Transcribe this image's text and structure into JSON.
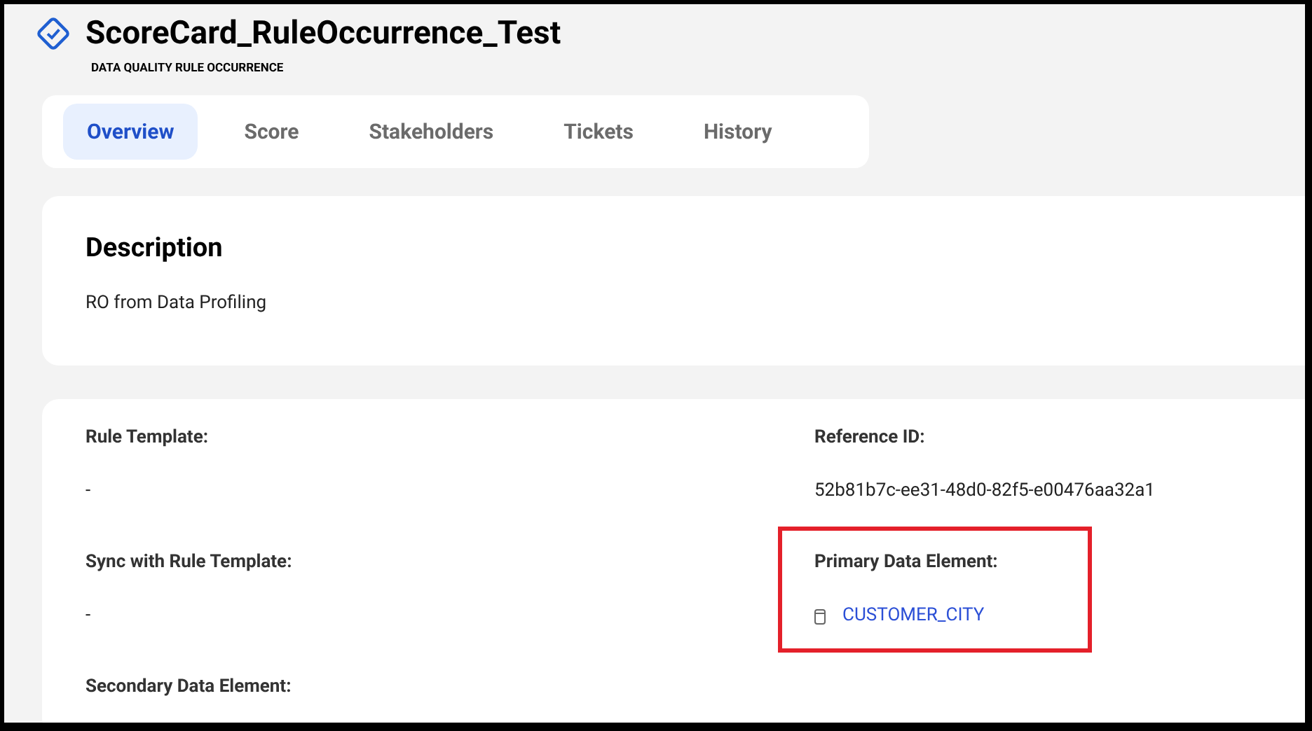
{
  "header": {
    "title": "ScoreCard_RuleOccurrence_Test",
    "subtitle": "DATA QUALITY RULE OCCURRENCE"
  },
  "tabs": [
    {
      "label": "Overview",
      "selected": true
    },
    {
      "label": "Score",
      "selected": false
    },
    {
      "label": "Stakeholders",
      "selected": false
    },
    {
      "label": "Tickets",
      "selected": false
    },
    {
      "label": "History",
      "selected": false
    }
  ],
  "description": {
    "title": "Description",
    "text": "RO from Data Profiling"
  },
  "fields": [
    {
      "label": "Rule Template:",
      "value": "-",
      "kind": "text",
      "highlighted": false
    },
    {
      "label": "Reference ID:",
      "value": "52b81b7c-ee31-48d0-82f5-e00476aa32a1",
      "kind": "text",
      "highlighted": false
    },
    {
      "label": "Sync with Rule Template:",
      "value": "-",
      "kind": "text",
      "highlighted": false
    },
    {
      "label": "Primary Data Element:",
      "value": "CUSTOMER_CITY",
      "kind": "link",
      "highlighted": true
    },
    {
      "label": "Secondary Data Element:",
      "highlighted": false
    }
  ]
}
